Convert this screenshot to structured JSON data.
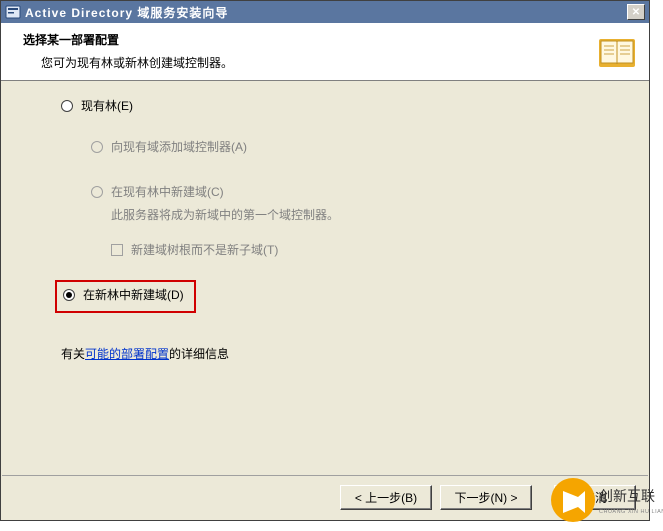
{
  "titlebar": {
    "title": "Active Directory 域服务安装向导",
    "close_label": "✕"
  },
  "header": {
    "title": "选择某一部署配置",
    "subtitle": "您可为现有林或新林创建域控制器。"
  },
  "options": {
    "existing_forest": {
      "label": "现有林(E)",
      "add_dc": "向现有域添加域控制器(A)",
      "new_domain": "在现有林中新建域(C)",
      "new_domain_desc": "此服务器将成为新域中的第一个域控制器。",
      "not_new_child": "新建域树根而不是新子域(T)"
    },
    "new_forest": {
      "label": "在新林中新建域(D)"
    }
  },
  "info": {
    "prefix": "有关",
    "link": "可能的部署配置",
    "suffix": "的详细信息"
  },
  "footer": {
    "back": "< 上一步(B)",
    "next": "下一步(N) >",
    "cancel": "取消"
  },
  "watermark": {
    "brand": "创新互联",
    "brand_py": "CHUANG XIN HU LIAN"
  }
}
